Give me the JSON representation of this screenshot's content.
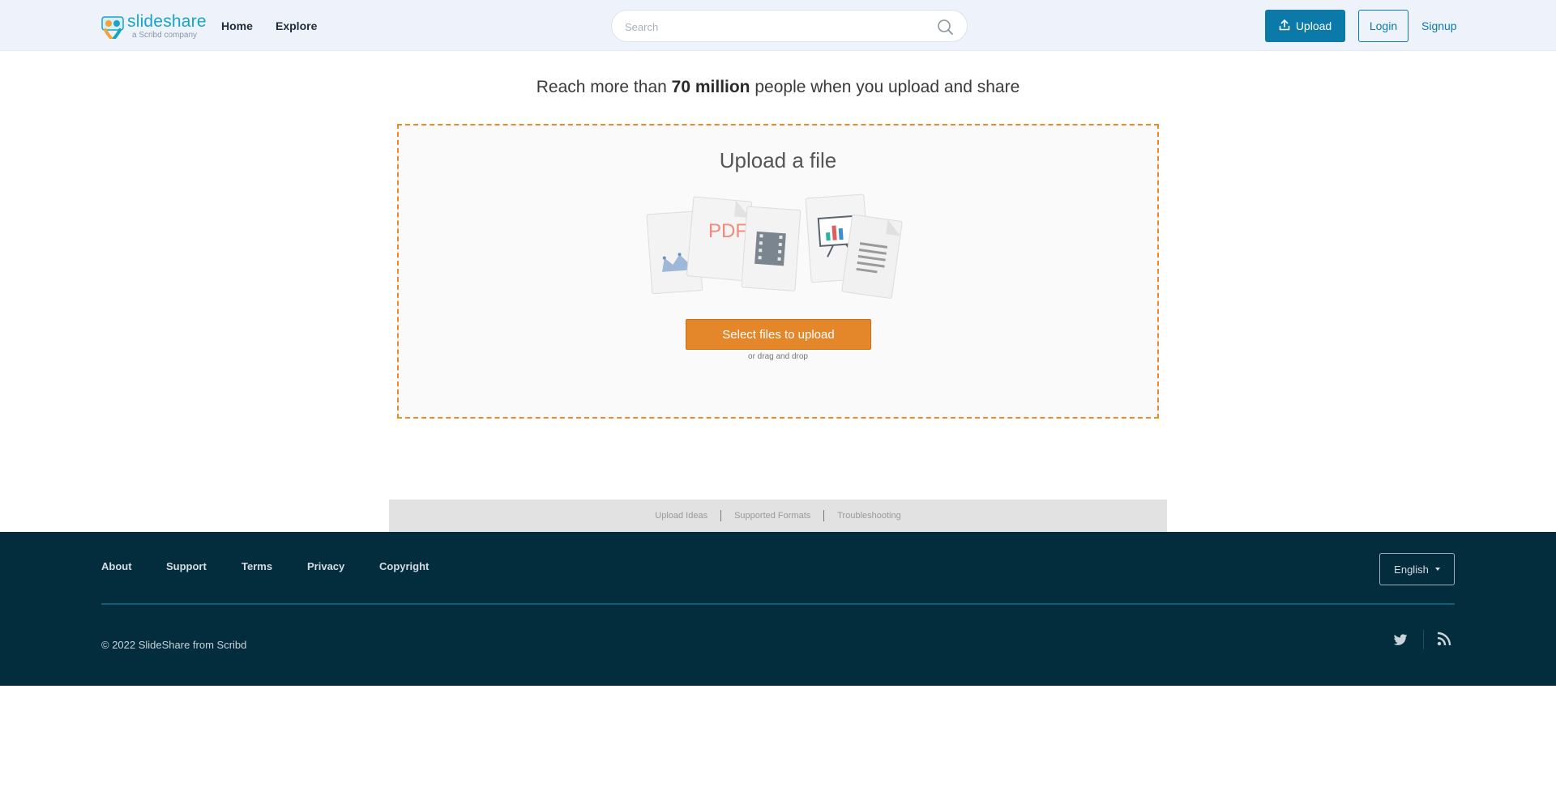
{
  "header": {
    "logo": {
      "name": "slideshare",
      "tagline": "a Scribd company"
    },
    "nav": [
      {
        "label": "Home"
      },
      {
        "label": "Explore"
      }
    ],
    "search": {
      "placeholder": "Search",
      "value": ""
    },
    "upload_label": "Upload",
    "login_label": "Login",
    "signup_label": "Signup"
  },
  "headline": {
    "prefix": "Reach more than ",
    "bold": "70 million",
    "suffix": " people when you upload and share"
  },
  "upload": {
    "title": "Upload a file",
    "pdf_label": "PDF",
    "button_label": "Select files to upload",
    "hint": "or drag and drop"
  },
  "help_links": [
    "Upload Ideas",
    "Supported Formats",
    "Troubleshooting"
  ],
  "footer": {
    "links": [
      "About",
      "Support",
      "Terms",
      "Privacy",
      "Copyright"
    ],
    "language": "English",
    "copyright": "© 2022 SlideShare from Scribd",
    "social": [
      "twitter-icon",
      "rss-icon"
    ]
  },
  "colors": {
    "brand_blue": "#0b7aa8",
    "accent_orange": "#e4862a",
    "footer_bg": "#032d3d",
    "header_bg": "#eef3fb"
  }
}
